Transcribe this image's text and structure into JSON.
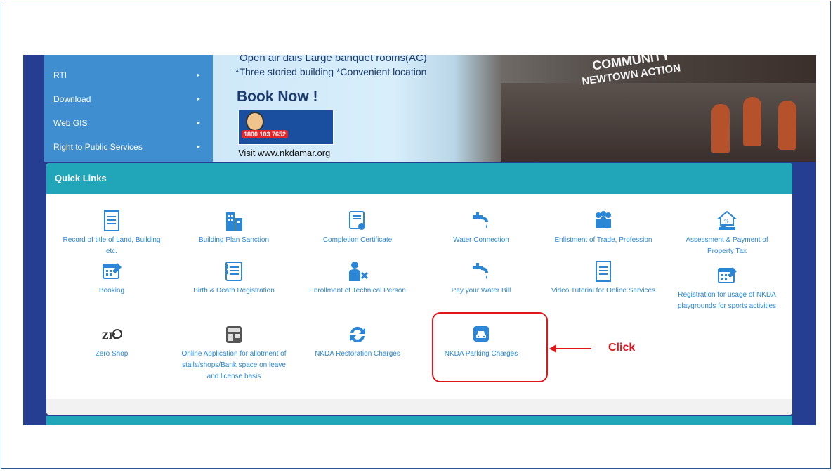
{
  "sidebar": {
    "items": [
      {
        "label": "RTI"
      },
      {
        "label": "Download"
      },
      {
        "label": "Web GIS"
      },
      {
        "label": "Right to Public Services"
      }
    ],
    "arrow": "▸"
  },
  "banner": {
    "line1": "Open air dais  Large banquet rooms(AC)",
    "line2": "*Three storied building *Convenient location",
    "cta": "Book Now !",
    "toll_free": "1800 103 7652",
    "visit": "Visit www.nkdamar.org",
    "building_sign_1": "COMMUNITY",
    "building_sign_2": "NEWTOWN ACTION"
  },
  "quick_links": {
    "title": "Quick Links",
    "items": [
      {
        "label": "Record of title of Land, Building etc.",
        "icon": "document-icon"
      },
      {
        "label": "Building Plan Sanction",
        "icon": "building-icon"
      },
      {
        "label": "Completion Certificate",
        "icon": "certificate-icon"
      },
      {
        "label": "Water Connection",
        "icon": "water-tap-icon"
      },
      {
        "label": "Enlistment of Trade, Profession",
        "icon": "people-icon"
      },
      {
        "label": "Assessment & Payment of Property Tax",
        "icon": "house-hand-icon"
      },
      {
        "label": "Booking",
        "icon": "calendar-icon"
      },
      {
        "label": "Birth & Death Registration",
        "icon": "register-icon"
      },
      {
        "label": "Enrollment of Technical Person",
        "icon": "technician-icon"
      },
      {
        "label": "Pay your Water Bill",
        "icon": "water-tap-icon"
      },
      {
        "label": "Video Tutorial for Online Services",
        "icon": "document-icon"
      },
      {
        "label": "Registration for usage of NKDA playgrounds for sports activities",
        "icon": "calendar-icon"
      },
      {
        "label": "Zero Shop",
        "icon": "zero-shop-logo"
      },
      {
        "label": "Online Application for allotment of stalls/shops/Bank space on leave and license basis",
        "icon": "shop-icon"
      },
      {
        "label": "NKDA Restoration Charges",
        "icon": "refresh-icon"
      },
      {
        "label": "NKDA Parking Charges",
        "icon": "car-icon"
      }
    ]
  },
  "annotation": {
    "label": "Click",
    "color": "#e0161b"
  },
  "colors": {
    "sidebar": "#3f8fd0",
    "site_bg": "#253e92",
    "header": "#20a6b8",
    "link": "#2b86d6"
  }
}
